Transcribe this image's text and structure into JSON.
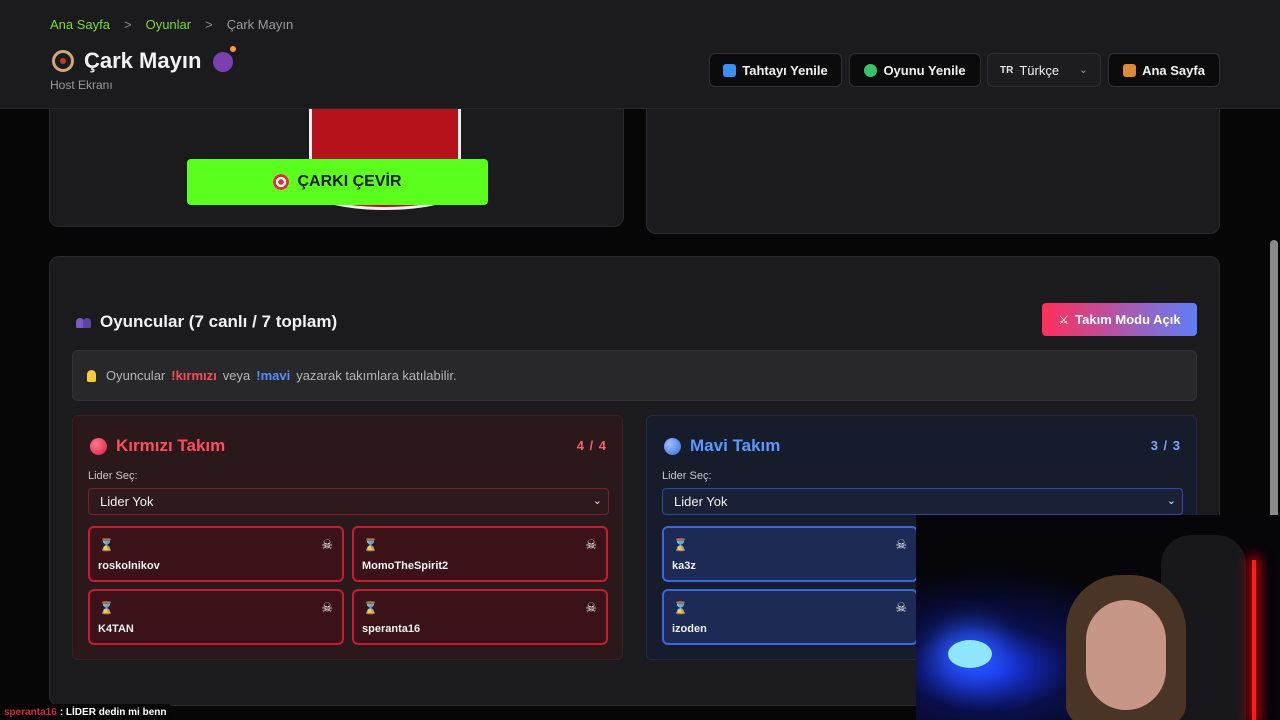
{
  "breadcrumb": {
    "home": "Ana Sayfa",
    "games": "Oyunlar",
    "current": "Çark Mayın",
    "sep": ">"
  },
  "header": {
    "title": "Çark Mayın",
    "subtitle": "Host Ekranı",
    "buttons": {
      "refresh_board": "Tahtayı Yenile",
      "restart_game": "Oyunu Yenile",
      "home": "Ana Sayfa"
    },
    "language": {
      "flag": "TR",
      "value": "Türkçe"
    }
  },
  "wheel": {
    "spin_label": "ÇARKI ÇEVİR"
  },
  "players": {
    "title": "Oyuncular (7 canlı / 7 toplam)",
    "team_mode_label": "Takım Modu Açık",
    "info": {
      "prefix": "Oyuncular",
      "red_cmd": "!kırmızı",
      "middle": "veya",
      "blue_cmd": "!mavi",
      "suffix": "yazarak takımlara katılabilir."
    },
    "red_team": {
      "name": "Kırmızı Takım",
      "count": "4 / 4",
      "leader_label": "Lider Seç:",
      "leader_value": "Lider Yok",
      "members": [
        "roskolnikov",
        "MomoTheSpirit2",
        "K4TAN",
        "speranta16"
      ]
    },
    "blue_team": {
      "name": "Mavi Takım",
      "count": "3 / 3",
      "leader_label": "Lider Seç:",
      "leader_value": "Lider Yok",
      "members": [
        "ka3z",
        "izoden"
      ]
    }
  },
  "chat": {
    "user": "speranta16",
    "message": ": LİDER dedin mi benn"
  },
  "colors": {
    "accent_green": "#5aff1e",
    "red_team": "#ff4d5e",
    "blue_team": "#5b97ff"
  }
}
